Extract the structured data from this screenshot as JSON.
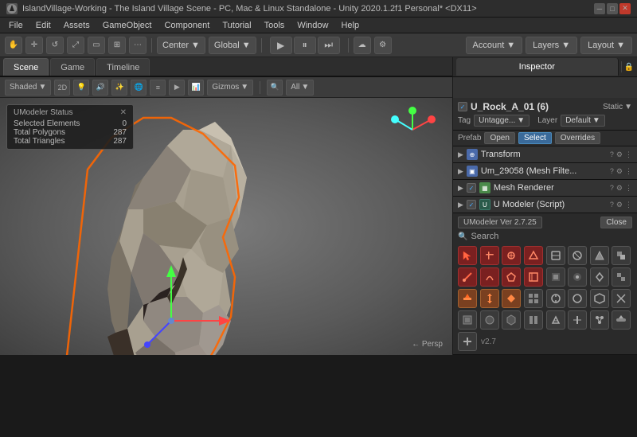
{
  "window": {
    "title": "IslandVillage-Working - The Island Village Scene - PC, Mac & Linux Standalone - Unity 2020.1.2f1 Personal* <DX11>",
    "icon": "unity-icon"
  },
  "menubar": {
    "items": [
      "File",
      "Edit",
      "Assets",
      "GameObject",
      "Component",
      "Tutorial",
      "Tools",
      "Window",
      "Help"
    ]
  },
  "toolbar": {
    "center_label": "Center",
    "global_label": "Global",
    "account_label": "Account",
    "layers_label": "Layers",
    "layout_label": "Layout"
  },
  "tabs": {
    "scene_label": "Scene",
    "game_label": "Game",
    "timeline_label": "Timeline"
  },
  "toolbar2": {
    "shaded_label": "Shaded",
    "d2_label": "2D",
    "gizmos_label": "Gizmos",
    "all_label": "All"
  },
  "umodeler_status": {
    "title": "UModeler Status",
    "selected_label": "Selected Elements",
    "selected_value": "0",
    "polygons_label": "Total Polygons",
    "polygons_value": "287",
    "triangles_label": "Total Triangles",
    "triangles_value": "287"
  },
  "viewport": {
    "persp_label": "← Persp"
  },
  "inspector": {
    "tabs": {
      "inspector_label": "Inspector",
      "account_label": "Account",
      "layers_label": "Layers"
    },
    "object": {
      "name": "U_Rock_A_01 (6)",
      "static_label": "Static",
      "tag_label": "Tag",
      "tag_value": "Untagge...",
      "layer_label": "Layer",
      "layer_value": "Default"
    },
    "prefab": {
      "label": "Prefab",
      "open_label": "Open",
      "select_label": "Select",
      "overrides_label": "Overrides"
    },
    "components": [
      {
        "name": "Transform",
        "icon": "transform-icon",
        "color": "blue"
      },
      {
        "name": "Um_29058 (Mesh Filte...",
        "icon": "mesh-filter-icon",
        "color": "blue"
      },
      {
        "name": "Mesh Renderer",
        "icon": "mesh-renderer-icon",
        "color": "green"
      },
      {
        "name": "U Modeler (Script)",
        "icon": "script-icon",
        "color": "dark"
      }
    ],
    "umodeler": {
      "version_label": "UModeler Ver 2.7.25",
      "close_label": "Close",
      "search_label": "Search"
    }
  },
  "icons": {
    "tool_symbols": [
      "⬛",
      "⬜",
      "⬟",
      "◆",
      "▲",
      "▶",
      "◉",
      "⊕",
      "⊞",
      "⊟",
      "⊠",
      "⊡",
      "▣",
      "⊹",
      "✦",
      "⬡",
      "⬢",
      "⬣",
      "◈",
      "◎",
      "⊗",
      "⊘",
      "⊙",
      "⊚",
      "⊛",
      "⊜",
      "⊝",
      "⊞",
      "⊟",
      "⊠",
      "⊡",
      "✧"
    ]
  }
}
